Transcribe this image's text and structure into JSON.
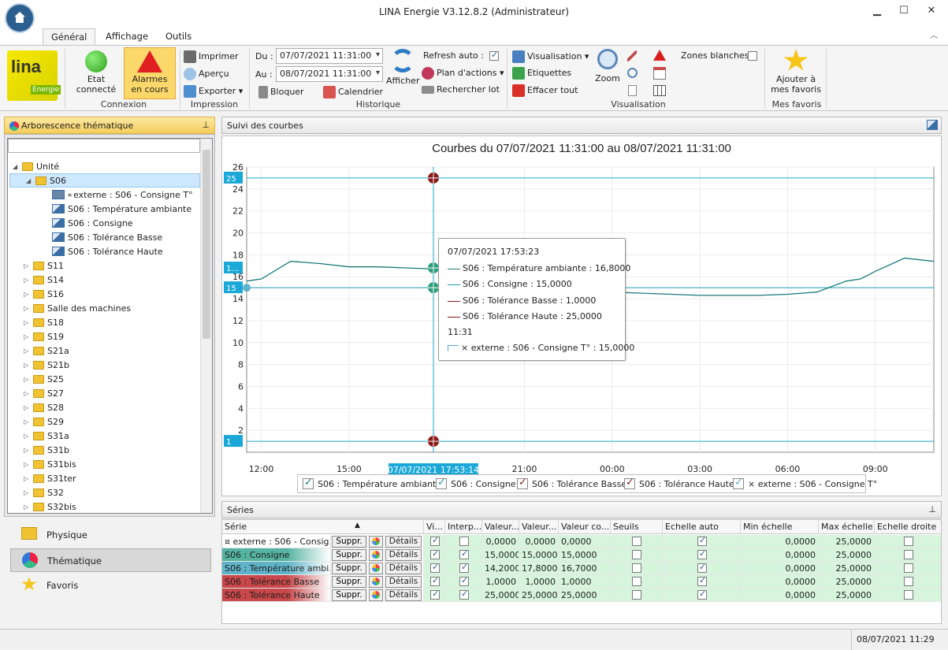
{
  "window": {
    "title": "LINA Energie  V3.12.8.2  (Administrateur)"
  },
  "tabs": [
    "Général",
    "Affichage",
    "Outils"
  ],
  "ribbon": {
    "logo_text": "lina",
    "logo_sub": "Energie",
    "connexion": {
      "etat_label": "Etat connecté",
      "alarmes_label": "Alarmes en cours",
      "group": "Connexion"
    },
    "impression": {
      "imprimer": "Imprimer",
      "apercu": "Aperçu",
      "exporter": "Exporter",
      "group": "Impression"
    },
    "historique": {
      "du_label": "Du :",
      "du_value": "07/07/2021 11:31:00",
      "au_label": "Au :",
      "au_value": "08/07/2021 11:31:00",
      "bloquer": "Bloquer",
      "calendrier": "Calendrier",
      "afficher": "Afficher",
      "refresh_auto": "Refresh auto :",
      "plan_actions": "Plan d'actions",
      "rechercher_lot": "Rechercher lot",
      "group": "Historique"
    },
    "visualisation": {
      "visualisation": "Visualisation",
      "etiquettes": "Etiquettes",
      "effacer_tout": "Effacer tout",
      "zoom": "Zoom",
      "zones_blanches": "Zones blanches",
      "group": "Visualisation"
    },
    "favoris": {
      "ajouter": "Ajouter à mes favoris",
      "group": "Mes favoris"
    }
  },
  "left_panel": {
    "title": "Arborescence thématique",
    "tree": {
      "root": "Unité",
      "selected": "S06",
      "children": [
        "externe : S06 - Consigne T°",
        "S06 : Température ambiante",
        "S06 : Consigne",
        "S06 : Tolérance Basse",
        "S06 : Tolérance Haute"
      ],
      "siblings": [
        "S11",
        "S14",
        "S16",
        "Salle des machines",
        "S18",
        "S19",
        "S21a",
        "S21b",
        "S25",
        "S27",
        "S28",
        "S29",
        "S31a",
        "S31b",
        "S31bis",
        "S31ter",
        "S32",
        "S32bis"
      ]
    },
    "nav": [
      "Physique",
      "Thématique",
      "Favoris"
    ]
  },
  "chart_panel": {
    "title": "Suivi des courbes"
  },
  "chart_data": {
    "type": "line",
    "title": "Courbes du 07/07/2021 11:31:00 au 08/07/2021 11:31:00",
    "ylim": [
      0,
      26
    ],
    "yticks": [
      2,
      4,
      6,
      8,
      10,
      12,
      14,
      16,
      18,
      20,
      22,
      24,
      26
    ],
    "xticks": [
      "12:00",
      "15:00",
      "21:00",
      "00:00",
      "03:00",
      "06:00",
      "09:00"
    ],
    "x_hours": [
      11.5,
      12,
      13,
      14,
      15,
      16,
      17,
      18,
      19,
      20,
      21,
      22,
      23,
      24,
      25,
      26,
      27,
      28,
      29,
      30,
      31,
      32,
      32.5,
      33,
      34,
      35
    ],
    "series": [
      {
        "name": "S06 : Température ambiante",
        "color": "#1a7a7a",
        "values": [
          15.6,
          15.8,
          17.4,
          17.2,
          16.9,
          16.9,
          16.8,
          16.7,
          16.2,
          15.3,
          15.0,
          14.9,
          14.7,
          14.6,
          14.5,
          14.4,
          14.3,
          14.3,
          14.3,
          14.4,
          14.6,
          15.6,
          15.8,
          16.5,
          17.7,
          17.4
        ]
      },
      {
        "name": "S06 : Consigne",
        "color": "#1a9bb0",
        "constant": 15
      },
      {
        "name": "S06 : Tolérance Basse",
        "color": "#8b1a1a",
        "constant": 1
      },
      {
        "name": "S06 : Tolérance Haute",
        "color": "#8b1a1a",
        "constant": 25
      },
      {
        "name": "externe : S06 - Consigne T°",
        "color": "#5fa8d3",
        "constant": 15
      }
    ],
    "cursor": {
      "x_hour": 17.887,
      "label": "07/07/2021 17:53:14"
    },
    "axis_badges": [
      "25",
      "1...",
      "15",
      "1"
    ],
    "tooltip": {
      "header": "07/07/2021 17:53:23",
      "rows": [
        "S06 : Température ambiante : 16,8000",
        "S06 : Consigne : 15,0000",
        "S06 : Tolérance Basse : 1,0000",
        "S06 : Tolérance Haute : 25,0000"
      ],
      "time": "11:31",
      "ext_row": "× externe : S06 - Consigne T° : 15,0000"
    },
    "legend": [
      "S06 : Température ambiante",
      "S06 : Consigne",
      "S06 : Tolérance Basse",
      "S06 : Tolérance Haute",
      "× externe : S06 - Consigne T°"
    ]
  },
  "series_panel": {
    "title": "Séries",
    "headers": [
      "Série",
      "Vi...",
      "Interp...",
      "Valeur...",
      "Valeur...",
      "Valeur co...",
      "Seuils",
      "Echelle auto",
      "Min échelle",
      "Max échelle",
      "Echelle droite"
    ],
    "suppr": "Suppr.",
    "details": "Détails",
    "rows": [
      {
        "name": "¤ externe : S06 - Consig...",
        "color": "#ffffff",
        "interp": false,
        "v1": "0,0000",
        "v2": "0,0000",
        "v3": "0,0000",
        "min": "0,0000",
        "max": "25,0000"
      },
      {
        "name": "S06 : Consigne",
        "color": "#56b3a2",
        "interp": true,
        "v1": "15,0000",
        "v2": "15,0000",
        "v3": "15,0000",
        "min": "0,0000",
        "max": "25,0000"
      },
      {
        "name": "S06 : Température ambi...",
        "color": "#5fb3c8",
        "interp": true,
        "v1": "14,2000",
        "v2": "17,8000",
        "v3": "16,7000",
        "min": "0,0000",
        "max": "25,0000"
      },
      {
        "name": "S06 : Tolérance Basse",
        "color": "#c8474a",
        "interp": true,
        "v1": "1,0000",
        "v2": "1,0000",
        "v3": "1,0000",
        "min": "0,0000",
        "max": "25,0000"
      },
      {
        "name": "S06 : Tolérance Haute",
        "color": "#c8474a",
        "interp": true,
        "v1": "25,0000",
        "v2": "25,0000",
        "v3": "25,0000",
        "min": "0,0000",
        "max": "25,0000"
      }
    ]
  },
  "status": {
    "datetime": "08/07/2021 11:29"
  }
}
